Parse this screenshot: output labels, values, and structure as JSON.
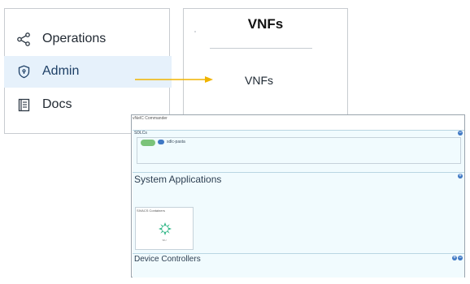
{
  "sidebar": {
    "items": [
      {
        "label": "Operations",
        "icon": "share-nodes-icon"
      },
      {
        "label": "Admin",
        "icon": "shield-icon",
        "active": true
      },
      {
        "label": "Docs",
        "icon": "book-icon"
      }
    ]
  },
  "vnf_panel": {
    "title": "VNFs",
    "subtitle": "VNFs"
  },
  "arrow_color": "#f0b400",
  "vnec": {
    "title": "vNeIC Commander",
    "sdlcs": {
      "label": "SDLCs",
      "chip_label": "sdlc-pasta"
    },
    "system_applications": {
      "label": "System Applications",
      "card_title": "SIVACS Containers",
      "card_caption": "SIU"
    },
    "device_controllers": {
      "label": "Device Controllers"
    }
  },
  "colors": {
    "active_bg": "#e6f1fb",
    "panel_bg": "#f1fbfe",
    "accent_blue": "#3f78c4",
    "toggle_green": "#7bc37a",
    "logo_green": "#36b98a"
  }
}
